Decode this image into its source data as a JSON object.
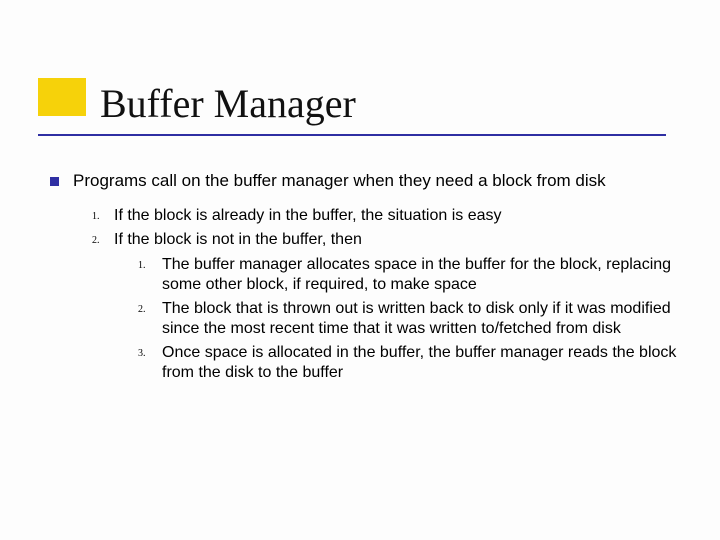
{
  "title": "Buffer Manager",
  "root": {
    "text": "Programs call on the buffer manager when they need a block from disk"
  },
  "items": [
    {
      "n": "1.",
      "text": "If the block is already in the buffer, the situation is easy"
    },
    {
      "n": "2.",
      "text": "If the block is not in the buffer, then"
    }
  ],
  "sub": [
    {
      "n": "1.",
      "text": "The buffer manager allocates space in the buffer for the block, replacing some other block, if required, to make space"
    },
    {
      "n": "2.",
      "text": "The block that is thrown out is written back to disk only if it was modified since the most recent time that it was written to/fetched from disk"
    },
    {
      "n": "3.",
      "text": "Once space is allocated in the buffer, the buffer manager reads the block from the disk to the buffer"
    }
  ]
}
